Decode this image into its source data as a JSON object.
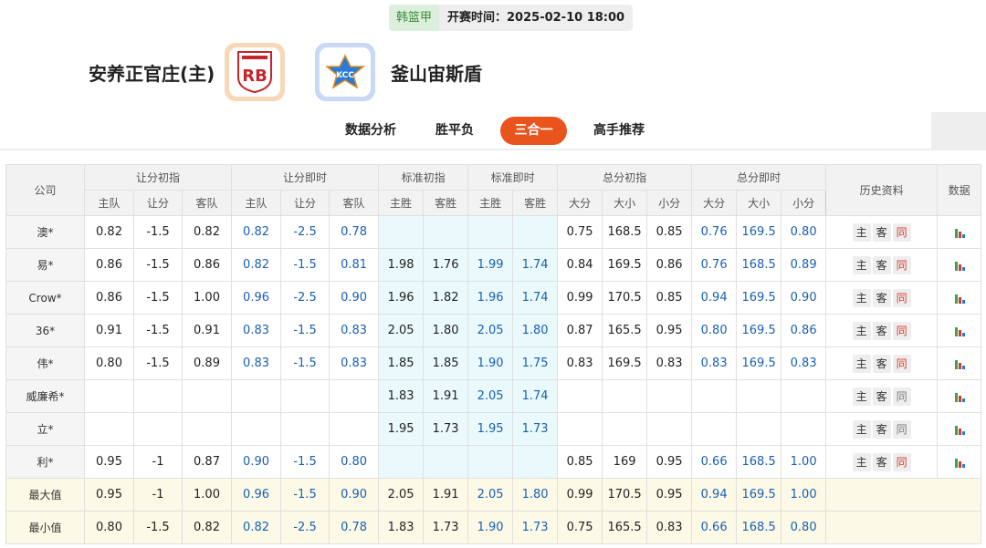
{
  "match": {
    "league": "韩篮甲",
    "start_time": "开赛时间：2025-02-10 18:00",
    "home_team": "安养正官庄(主)",
    "away_team": "釜山宙斯盾",
    "home_logo_text": "RB",
    "away_logo_text": "KCC"
  },
  "tabs": [
    {
      "label": "数据分析",
      "active": false
    },
    {
      "label": "胜平负",
      "active": false
    },
    {
      "label": "三合一",
      "active": true
    },
    {
      "label": "高手推荐",
      "active": false
    }
  ],
  "table": {
    "header_groups": {
      "company": "公司",
      "handicap_init": "让分初指",
      "handicap_live": "让分即时",
      "std_init": "标准初指",
      "std_live": "标准即时",
      "total_init": "总分初指",
      "total_live": "总分即时",
      "history": "历史资料",
      "data": "数据"
    },
    "sub_headers": {
      "home": "主队",
      "line": "让分",
      "away": "客队",
      "home_win": "主胜",
      "away_win": "客胜",
      "over": "大分",
      "total": "大小",
      "under": "小分"
    },
    "history_buttons": {
      "home": "主",
      "away": "客",
      "same": "同"
    },
    "rows": [
      {
        "company": "澳*",
        "hi": [
          "0.82",
          "-1.5",
          "0.82"
        ],
        "hl": [
          "0.82",
          "-2.5",
          "0.78"
        ],
        "si": [
          "",
          ""
        ],
        "sl": [
          "",
          ""
        ],
        "ti": [
          "0.75",
          "168.5",
          "0.85"
        ],
        "tl": [
          "0.76",
          "169.5",
          "0.80"
        ],
        "same_red": true
      },
      {
        "company": "易*",
        "hi": [
          "0.86",
          "-1.5",
          "0.86"
        ],
        "hl": [
          "0.82",
          "-1.5",
          "0.81"
        ],
        "si": [
          "1.98",
          "1.76"
        ],
        "sl": [
          "1.99",
          "1.74"
        ],
        "ti": [
          "0.84",
          "169.5",
          "0.86"
        ],
        "tl": [
          "0.76",
          "168.5",
          "0.89"
        ],
        "same_red": true
      },
      {
        "company": "Crow*",
        "hi": [
          "0.86",
          "-1.5",
          "1.00"
        ],
        "hl": [
          "0.96",
          "-2.5",
          "0.90"
        ],
        "si": [
          "1.96",
          "1.82"
        ],
        "sl": [
          "1.96",
          "1.74"
        ],
        "ti": [
          "0.99",
          "170.5",
          "0.85"
        ],
        "tl": [
          "0.94",
          "169.5",
          "0.90"
        ],
        "same_red": true
      },
      {
        "company": "36*",
        "hi": [
          "0.91",
          "-1.5",
          "0.91"
        ],
        "hl": [
          "0.83",
          "-1.5",
          "0.83"
        ],
        "si": [
          "2.05",
          "1.80"
        ],
        "sl": [
          "2.05",
          "1.80"
        ],
        "ti": [
          "0.87",
          "165.5",
          "0.95"
        ],
        "tl": [
          "0.80",
          "169.5",
          "0.86"
        ],
        "same_red": true
      },
      {
        "company": "伟*",
        "hi": [
          "0.80",
          "-1.5",
          "0.89"
        ],
        "hl": [
          "0.83",
          "-1.5",
          "0.83"
        ],
        "si": [
          "1.85",
          "1.85"
        ],
        "sl": [
          "1.90",
          "1.75"
        ],
        "ti": [
          "0.83",
          "169.5",
          "0.83"
        ],
        "tl": [
          "0.83",
          "169.5",
          "0.83"
        ],
        "same_red": true
      },
      {
        "company": "威廉希*",
        "hi": [
          "",
          "",
          ""
        ],
        "hl": [
          "",
          "",
          ""
        ],
        "si": [
          "1.83",
          "1.91"
        ],
        "sl": [
          "2.05",
          "1.74"
        ],
        "ti": [
          "",
          "",
          ""
        ],
        "tl": [
          "",
          "",
          ""
        ],
        "same_red": false
      },
      {
        "company": "立*",
        "hi": [
          "",
          "",
          ""
        ],
        "hl": [
          "",
          "",
          ""
        ],
        "si": [
          "1.95",
          "1.73"
        ],
        "sl": [
          "1.95",
          "1.73"
        ],
        "ti": [
          "",
          "",
          ""
        ],
        "tl": [
          "",
          "",
          ""
        ],
        "same_red": false
      },
      {
        "company": "利*",
        "hi": [
          "0.95",
          "-1",
          "0.87"
        ],
        "hl": [
          "0.90",
          "-1.5",
          "0.80"
        ],
        "si": [
          "",
          ""
        ],
        "sl": [
          "",
          ""
        ],
        "ti": [
          "0.85",
          "169",
          "0.95"
        ],
        "tl": [
          "0.66",
          "168.5",
          "1.00"
        ],
        "same_red": true
      }
    ],
    "summary": [
      {
        "label": "最大值",
        "hi": [
          "0.95",
          "-1",
          "1.00"
        ],
        "hl": [
          "0.96",
          "-1.5",
          "0.90"
        ],
        "si": [
          "2.05",
          "1.91"
        ],
        "sl": [
          "2.05",
          "1.80"
        ],
        "ti": [
          "0.99",
          "170.5",
          "0.95"
        ],
        "tl": [
          "0.94",
          "169.5",
          "1.00"
        ]
      },
      {
        "label": "最小值",
        "hi": [
          "0.80",
          "-1.5",
          "0.82"
        ],
        "hl": [
          "0.82",
          "-2.5",
          "0.78"
        ],
        "si": [
          "1.83",
          "1.73"
        ],
        "sl": [
          "1.90",
          "1.73"
        ],
        "ti": [
          "0.75",
          "165.5",
          "0.83"
        ],
        "tl": [
          "0.66",
          "168.5",
          "0.80"
        ]
      }
    ]
  },
  "colors": {
    "accent": "#e8541c",
    "live_value": "#1a5fb4",
    "std_bg": "#eaf9fb",
    "summary_bg": "#fcf9e6",
    "same_red": "#d53a2a"
  }
}
